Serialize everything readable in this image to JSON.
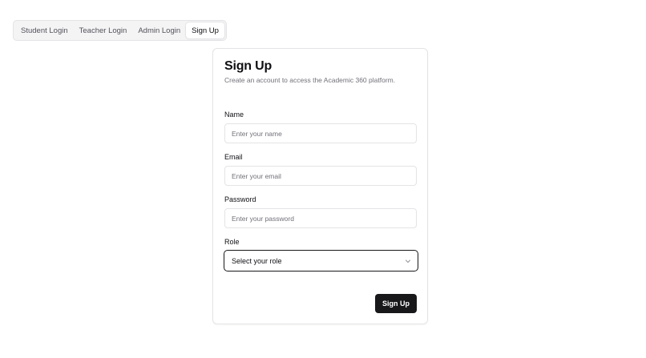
{
  "tabs": [
    {
      "label": "Student Login",
      "active": false
    },
    {
      "label": "Teacher Login",
      "active": false
    },
    {
      "label": "Admin Login",
      "active": false
    },
    {
      "label": "Sign Up",
      "active": true
    }
  ],
  "card": {
    "title": "Sign Up",
    "description": "Create an account to access the Academic 360 platform."
  },
  "form": {
    "name": {
      "label": "Name",
      "placeholder": "Enter your name",
      "value": ""
    },
    "email": {
      "label": "Email",
      "placeholder": "Enter your email",
      "value": ""
    },
    "password": {
      "label": "Password",
      "placeholder": "Enter your password",
      "value": ""
    },
    "role": {
      "label": "Role",
      "selected": "Select your role",
      "icon": "chevron-down-icon"
    },
    "submit_label": "Sign Up"
  },
  "colors": {
    "primary": "#18181b",
    "border": "#e4e4e7",
    "muted_text": "#71717a",
    "tab_background": "#f4f4f5"
  }
}
